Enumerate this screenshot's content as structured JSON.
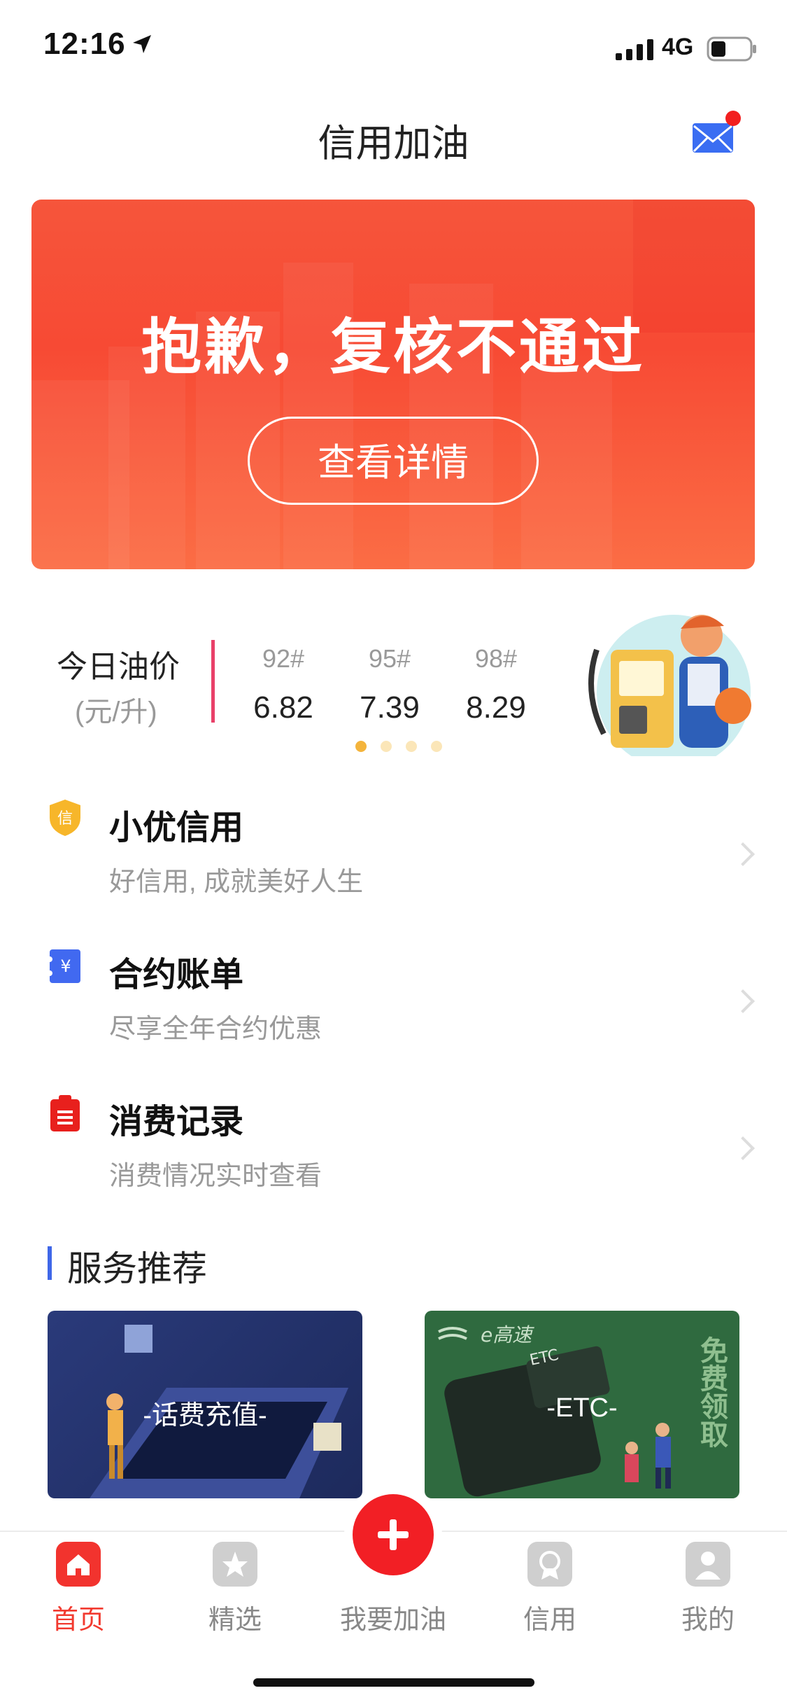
{
  "status_bar": {
    "time": "12:16",
    "network": "4G"
  },
  "header": {
    "title": "信用加油"
  },
  "banner": {
    "message": "抱歉，复核不通过",
    "button_label": "查看详情"
  },
  "oil_price": {
    "title": "今日油价",
    "unit": "(元/升)",
    "grades": [
      {
        "grade": "92#",
        "price": "6.82"
      },
      {
        "grade": "95#",
        "price": "7.39"
      },
      {
        "grade": "98#",
        "price": "8.29"
      }
    ],
    "carousel_count": 4,
    "carousel_active": 1
  },
  "menu": [
    {
      "title": "小优信用",
      "subtitle": "好信用, 成就美好人生",
      "icon": "shield-credit-icon",
      "icon_char": "信",
      "color": "#f7b62a"
    },
    {
      "title": "合约账单",
      "subtitle": "尽享全年合约优惠",
      "icon": "bill-icon",
      "icon_char": "¥",
      "color": "#4169f0"
    },
    {
      "title": "消费记录",
      "subtitle": "消费情况实时查看",
      "icon": "clipboard-icon",
      "icon_char": "",
      "color": "#e8201d"
    }
  ],
  "services": {
    "title": "服务推荐",
    "items": [
      {
        "label": "-话费充值-"
      },
      {
        "label": "-ETC-",
        "brand": "e高速",
        "badge": "ETC",
        "promo": "免费领取"
      }
    ]
  },
  "tabbar": {
    "items": [
      {
        "label": "首页",
        "active": true
      },
      {
        "label": "精选"
      },
      {
        "label": "我要加油"
      },
      {
        "label": "信用"
      },
      {
        "label": "我的"
      }
    ]
  },
  "colors": {
    "accent": "#f23a2f",
    "brand_red": "#f74a34",
    "blue": "#3f67e8"
  }
}
